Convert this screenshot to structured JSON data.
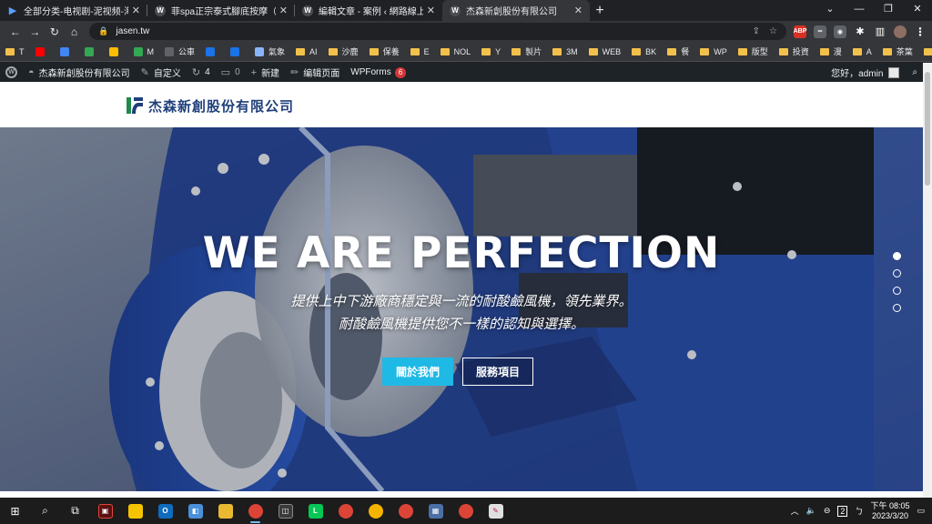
{
  "browser": {
    "tabs": [
      {
        "title": "全部分类-电视剧-泥视频-海外华人",
        "icon": "play-icon"
      },
      {
        "title": "菲spa正宗泰式腳底按摩（高雄市",
        "icon": "wordpress-icon"
      },
      {
        "title": "編輯文章 - 案例 ‹ 網路線上工作室",
        "icon": "wordpress-icon"
      },
      {
        "title": "杰森新創股份有限公司",
        "icon": "wordpress-icon",
        "active": true
      }
    ],
    "url": "jasen.tw",
    "bookmarks": [
      {
        "label": "T",
        "type": "folder"
      },
      {
        "label": "",
        "type": "youtube",
        "color": "#ff0000"
      },
      {
        "label": "",
        "type": "app",
        "color": "#4285f4"
      },
      {
        "label": "",
        "type": "app",
        "color": "#34a853"
      },
      {
        "label": "",
        "type": "maps",
        "color": "#fbbc05"
      },
      {
        "label": "M",
        "type": "maps",
        "color": "#34a853"
      },
      {
        "label": "公車",
        "type": "app",
        "color": "#5f6368"
      },
      {
        "label": "",
        "type": "app",
        "color": "#1a73e8"
      },
      {
        "label": "",
        "type": "app",
        "color": "#1a73e8"
      },
      {
        "label": "氣象",
        "type": "app",
        "color": "#8ab4f8"
      },
      {
        "label": "AI",
        "type": "folder"
      },
      {
        "label": "沙鹿",
        "type": "folder"
      },
      {
        "label": "保養",
        "type": "folder"
      },
      {
        "label": "E",
        "type": "folder"
      },
      {
        "label": "NOL",
        "type": "folder"
      },
      {
        "label": "Y",
        "type": "folder"
      },
      {
        "label": "製片",
        "type": "folder"
      },
      {
        "label": "3M",
        "type": "folder"
      },
      {
        "label": "WEB",
        "type": "folder"
      },
      {
        "label": "BK",
        "type": "folder"
      },
      {
        "label": "餐",
        "type": "folder"
      },
      {
        "label": "WP",
        "type": "folder"
      },
      {
        "label": "版型",
        "type": "folder"
      },
      {
        "label": "投資",
        "type": "folder"
      },
      {
        "label": "漫",
        "type": "folder"
      },
      {
        "label": "A",
        "type": "folder"
      },
      {
        "label": "茶葉",
        "type": "folder"
      },
      {
        "label": "作品",
        "type": "folder"
      }
    ],
    "more_bookmarks": "»"
  },
  "admin_bar": {
    "site_name": "杰森新創股份有限公司",
    "customize": "自定义",
    "updates": "4",
    "comments": "0",
    "new": "新建",
    "edit_page": "编辑页面",
    "wpforms": "WPForms",
    "wpforms_badge": "6",
    "greeting": "您好，admin"
  },
  "site": {
    "logo_text": "杰森新創股份有限公司",
    "brand_color": "#1f3f7a"
  },
  "hero": {
    "title": "WE ARE PERFECTION",
    "subtitle_line1": "提供上中下游廠商穩定與一流的耐酸鹼風機，領先業界。",
    "subtitle_line2": "耐酸鹼風機提供您不一樣的認知與選擇。",
    "primary_button": "關於我們",
    "secondary_button": "服務項目",
    "accent_color": "#1fb9e6",
    "slide_count": 4,
    "active_slide": 1
  },
  "taskbar": {
    "clock_time": "下午 08:05",
    "clock_date": "2023/3/20",
    "notification_count": "2"
  }
}
